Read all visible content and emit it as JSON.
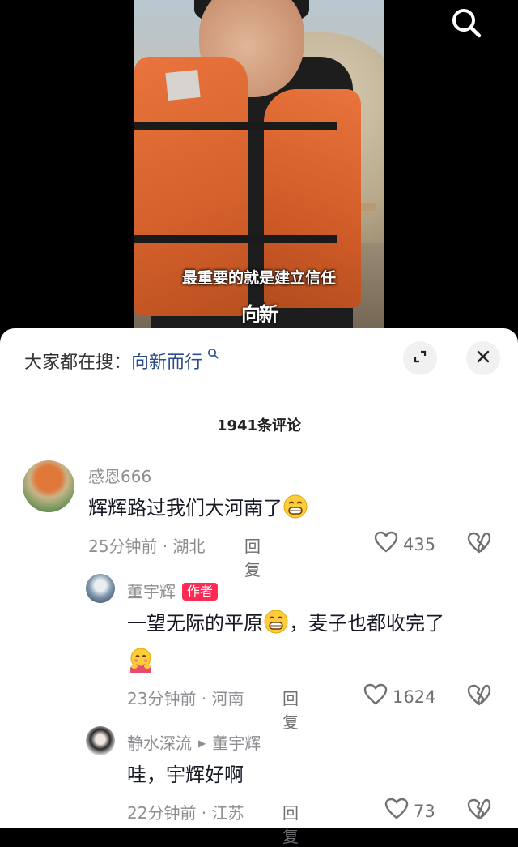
{
  "video": {
    "subtitle": "最重要的就是建立信任",
    "logo_text": "向新"
  },
  "sheet": {
    "trend_label": "大家都在搜：",
    "trend_query": "向新而行",
    "comment_count": "1941条评论"
  },
  "comments": [
    {
      "username": "感恩666",
      "text": "辉辉路过我们大河南了",
      "time_location": "25分钟前 · 湖北",
      "reply": "回复",
      "likes": "435"
    },
    {
      "username": "董宇辉",
      "badge": "作者",
      "text_line1_a": "一望无际的平原",
      "text_line1_b": "，麦子也都收完了",
      "time_location": "23分钟前 · 河南",
      "reply": "回复",
      "likes": "1624"
    },
    {
      "username": "静水深流",
      "reply_to": "董宇辉",
      "text": "哇，宇辉好啊",
      "time_location": "22分钟前 · 江苏",
      "reply": "回复",
      "likes": "73"
    }
  ]
}
